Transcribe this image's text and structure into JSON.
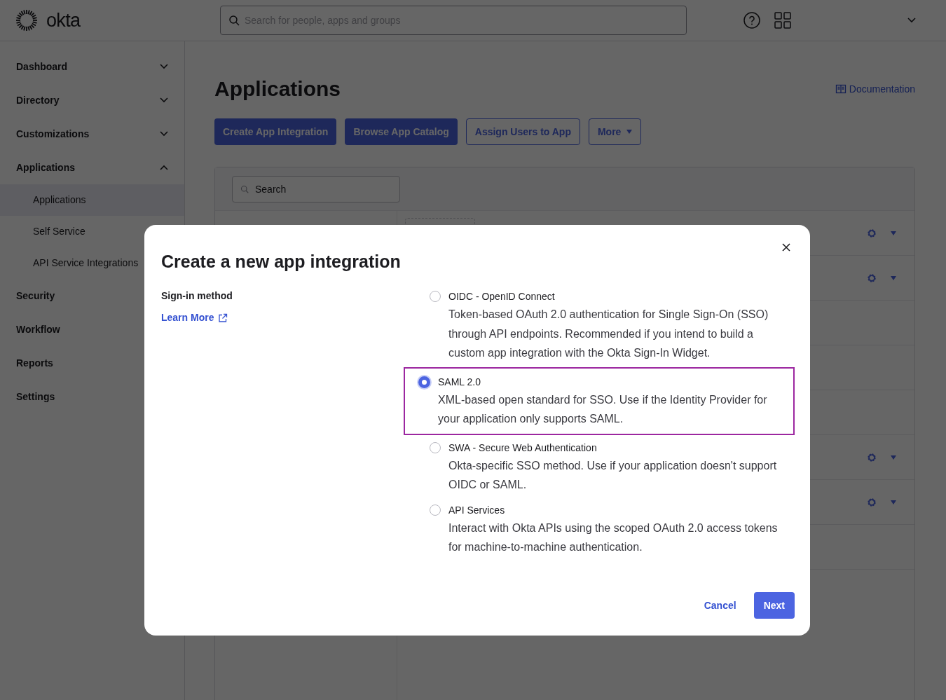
{
  "header": {
    "brand": "okta",
    "search": {
      "placeholder": "Search for people, apps and groups"
    }
  },
  "sidebar": {
    "items": [
      {
        "label": "Dashboard",
        "expanded": false
      },
      {
        "label": "Directory",
        "expanded": false
      },
      {
        "label": "Customizations",
        "expanded": false
      },
      {
        "label": "Applications",
        "expanded": true,
        "children": [
          {
            "label": "Applications",
            "selected": true
          },
          {
            "label": "Self Service",
            "selected": false
          },
          {
            "label": "API Service Integrations",
            "selected": false
          }
        ]
      },
      {
        "label": "Security",
        "expanded": false
      },
      {
        "label": "Workflow",
        "expanded": false
      },
      {
        "label": "Reports",
        "expanded": false
      },
      {
        "label": "Settings",
        "expanded": false
      }
    ]
  },
  "page": {
    "title": "Applications",
    "documentation_link": "Documentation",
    "buttons": [
      {
        "label": "Create App Integration",
        "kind": "primary"
      },
      {
        "label": "Browse App Catalog",
        "kind": "primary"
      },
      {
        "label": "Assign Users to App",
        "kind": "outline"
      },
      {
        "label": "More",
        "kind": "dropdown"
      }
    ],
    "table": {
      "search": {
        "placeholder": "Search"
      },
      "rows": [
        {
          "actions": true
        },
        {
          "actions": true
        },
        {
          "actions": false
        },
        {
          "actions": false
        },
        {
          "actions": false
        },
        {
          "actions": true
        },
        {
          "actions": true
        },
        {
          "actions": false
        }
      ]
    }
  },
  "dialog": {
    "title": "Create a new app integration",
    "label": "Sign-in method",
    "learn_more": "Learn More",
    "options": [
      {
        "label": "OIDC - OpenID Connect",
        "description": "Token-based OAuth 2.0 authentication for Single Sign-On (SSO) through API endpoints. Recommended if you intend to build a custom app integration with the Okta Sign-In Widget.",
        "selected": false
      },
      {
        "label": "SAML 2.0",
        "description": "XML-based open standard for SSO. Use if the Identity Provider for your application only supports SAML.",
        "selected": true
      },
      {
        "label": "SWA - Secure Web Authentication",
        "description": "Okta-specific SSO method. Use if your application doesn't support OIDC or SAML.",
        "selected": false
      },
      {
        "label": "API Services",
        "description": "Interact with Okta APIs using the scoped OAuth 2.0 access tokens for machine-to-machine authentication.",
        "selected": false
      }
    ],
    "cancel": "Cancel",
    "next": "Next"
  }
}
